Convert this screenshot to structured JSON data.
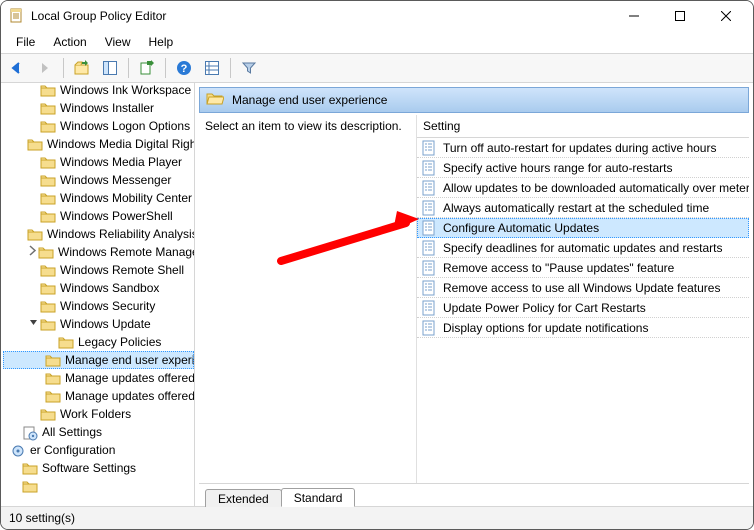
{
  "window": {
    "title": "Local Group Policy Editor"
  },
  "menubar": [
    "File",
    "Action",
    "View",
    "Help"
  ],
  "toolbar_icons": [
    {
      "name": "back-icon",
      "label": "←",
      "color": "#1e6fd6",
      "disabled": false
    },
    {
      "name": "forward-icon",
      "label": "→",
      "color": "#808080",
      "disabled": true
    },
    {
      "name": "sep"
    },
    {
      "name": "up-icon",
      "label": "folder-up"
    },
    {
      "name": "show-hide-tree-icon",
      "label": "tree"
    },
    {
      "name": "sep"
    },
    {
      "name": "export-icon",
      "label": "export"
    },
    {
      "name": "sep"
    },
    {
      "name": "help-icon",
      "label": "?",
      "color": "#1e6fd6"
    },
    {
      "name": "properties-icon",
      "label": "props"
    },
    {
      "name": "sep"
    },
    {
      "name": "filter-icon",
      "label": "▽",
      "color": "#5a7aa0"
    }
  ],
  "nav": {
    "items": [
      {
        "indent": 1,
        "twisty": "",
        "icon": "folder",
        "label": "Windows Ink Workspace",
        "sel": false
      },
      {
        "indent": 1,
        "twisty": "",
        "icon": "folder",
        "label": "Windows Installer",
        "sel": false
      },
      {
        "indent": 1,
        "twisty": "",
        "icon": "folder",
        "label": "Windows Logon Options",
        "sel": false
      },
      {
        "indent": 1,
        "twisty": "",
        "icon": "folder",
        "label": "Windows Media Digital Rights",
        "sel": false
      },
      {
        "indent": 1,
        "twisty": "",
        "icon": "folder",
        "label": "Windows Media Player",
        "sel": false
      },
      {
        "indent": 1,
        "twisty": "",
        "icon": "folder",
        "label": "Windows Messenger",
        "sel": false
      },
      {
        "indent": 1,
        "twisty": "",
        "icon": "folder",
        "label": "Windows Mobility Center",
        "sel": false
      },
      {
        "indent": 1,
        "twisty": "",
        "icon": "folder",
        "label": "Windows PowerShell",
        "sel": false
      },
      {
        "indent": 1,
        "twisty": "",
        "icon": "folder",
        "label": "Windows Reliability Analysis",
        "sel": false
      },
      {
        "indent": 1,
        "twisty": ">",
        "icon": "folder",
        "label": "Windows Remote Management",
        "sel": false
      },
      {
        "indent": 1,
        "twisty": "",
        "icon": "folder",
        "label": "Windows Remote Shell",
        "sel": false
      },
      {
        "indent": 1,
        "twisty": "",
        "icon": "folder",
        "label": "Windows Sandbox",
        "sel": false
      },
      {
        "indent": 1,
        "twisty": "",
        "icon": "folder",
        "label": "Windows Security",
        "sel": false
      },
      {
        "indent": 1,
        "twisty": "v",
        "icon": "folder",
        "label": "Windows Update",
        "sel": false
      },
      {
        "indent": 2,
        "twisty": "",
        "icon": "folder",
        "label": "Legacy Policies",
        "sel": false
      },
      {
        "indent": 2,
        "twisty": "",
        "icon": "folder",
        "label": "Manage end user experience",
        "sel": true
      },
      {
        "indent": 2,
        "twisty": "",
        "icon": "folder",
        "label": "Manage updates offered",
        "sel": false
      },
      {
        "indent": 2,
        "twisty": "",
        "icon": "folder",
        "label": "Manage updates offered",
        "sel": false
      },
      {
        "indent": 1,
        "twisty": "",
        "icon": "folder",
        "label": "Work Folders",
        "sel": false
      },
      {
        "indent": 0,
        "twisty": "",
        "icon": "settings",
        "label": "All Settings",
        "sel": false
      },
      {
        "indent": -1,
        "twisty": "",
        "icon": "cog",
        "label": "er Configuration",
        "sel": false
      },
      {
        "indent": 0,
        "twisty": "",
        "icon": "folder",
        "label": "Software Settings",
        "sel": false
      },
      {
        "indent": 0,
        "twisty": "",
        "icon": "folder-trunc",
        "label": "",
        "sel": false
      }
    ]
  },
  "folder_header": "Manage end user experience",
  "desc_hint": "Select an item to view its description.",
  "list_header": "Setting",
  "settings": [
    {
      "label": "Turn off auto-restart for updates during active hours",
      "sel": false
    },
    {
      "label": "Specify active hours range for auto-restarts",
      "sel": false
    },
    {
      "label": "Allow updates to be downloaded automatically over metered",
      "sel": false
    },
    {
      "label": "Always automatically restart at the scheduled time",
      "sel": false
    },
    {
      "label": "Configure Automatic Updates",
      "sel": true
    },
    {
      "label": "Specify deadlines for automatic updates and restarts",
      "sel": false
    },
    {
      "label": "Remove access to \"Pause updates\" feature",
      "sel": false
    },
    {
      "label": "Remove access to use all Windows Update features",
      "sel": false
    },
    {
      "label": "Update Power Policy for Cart Restarts",
      "sel": false
    },
    {
      "label": "Display options for update notifications",
      "sel": false
    }
  ],
  "tabs": [
    {
      "label": "Extended",
      "active": false
    },
    {
      "label": "Standard",
      "active": true
    }
  ],
  "statusbar": "10 setting(s)"
}
